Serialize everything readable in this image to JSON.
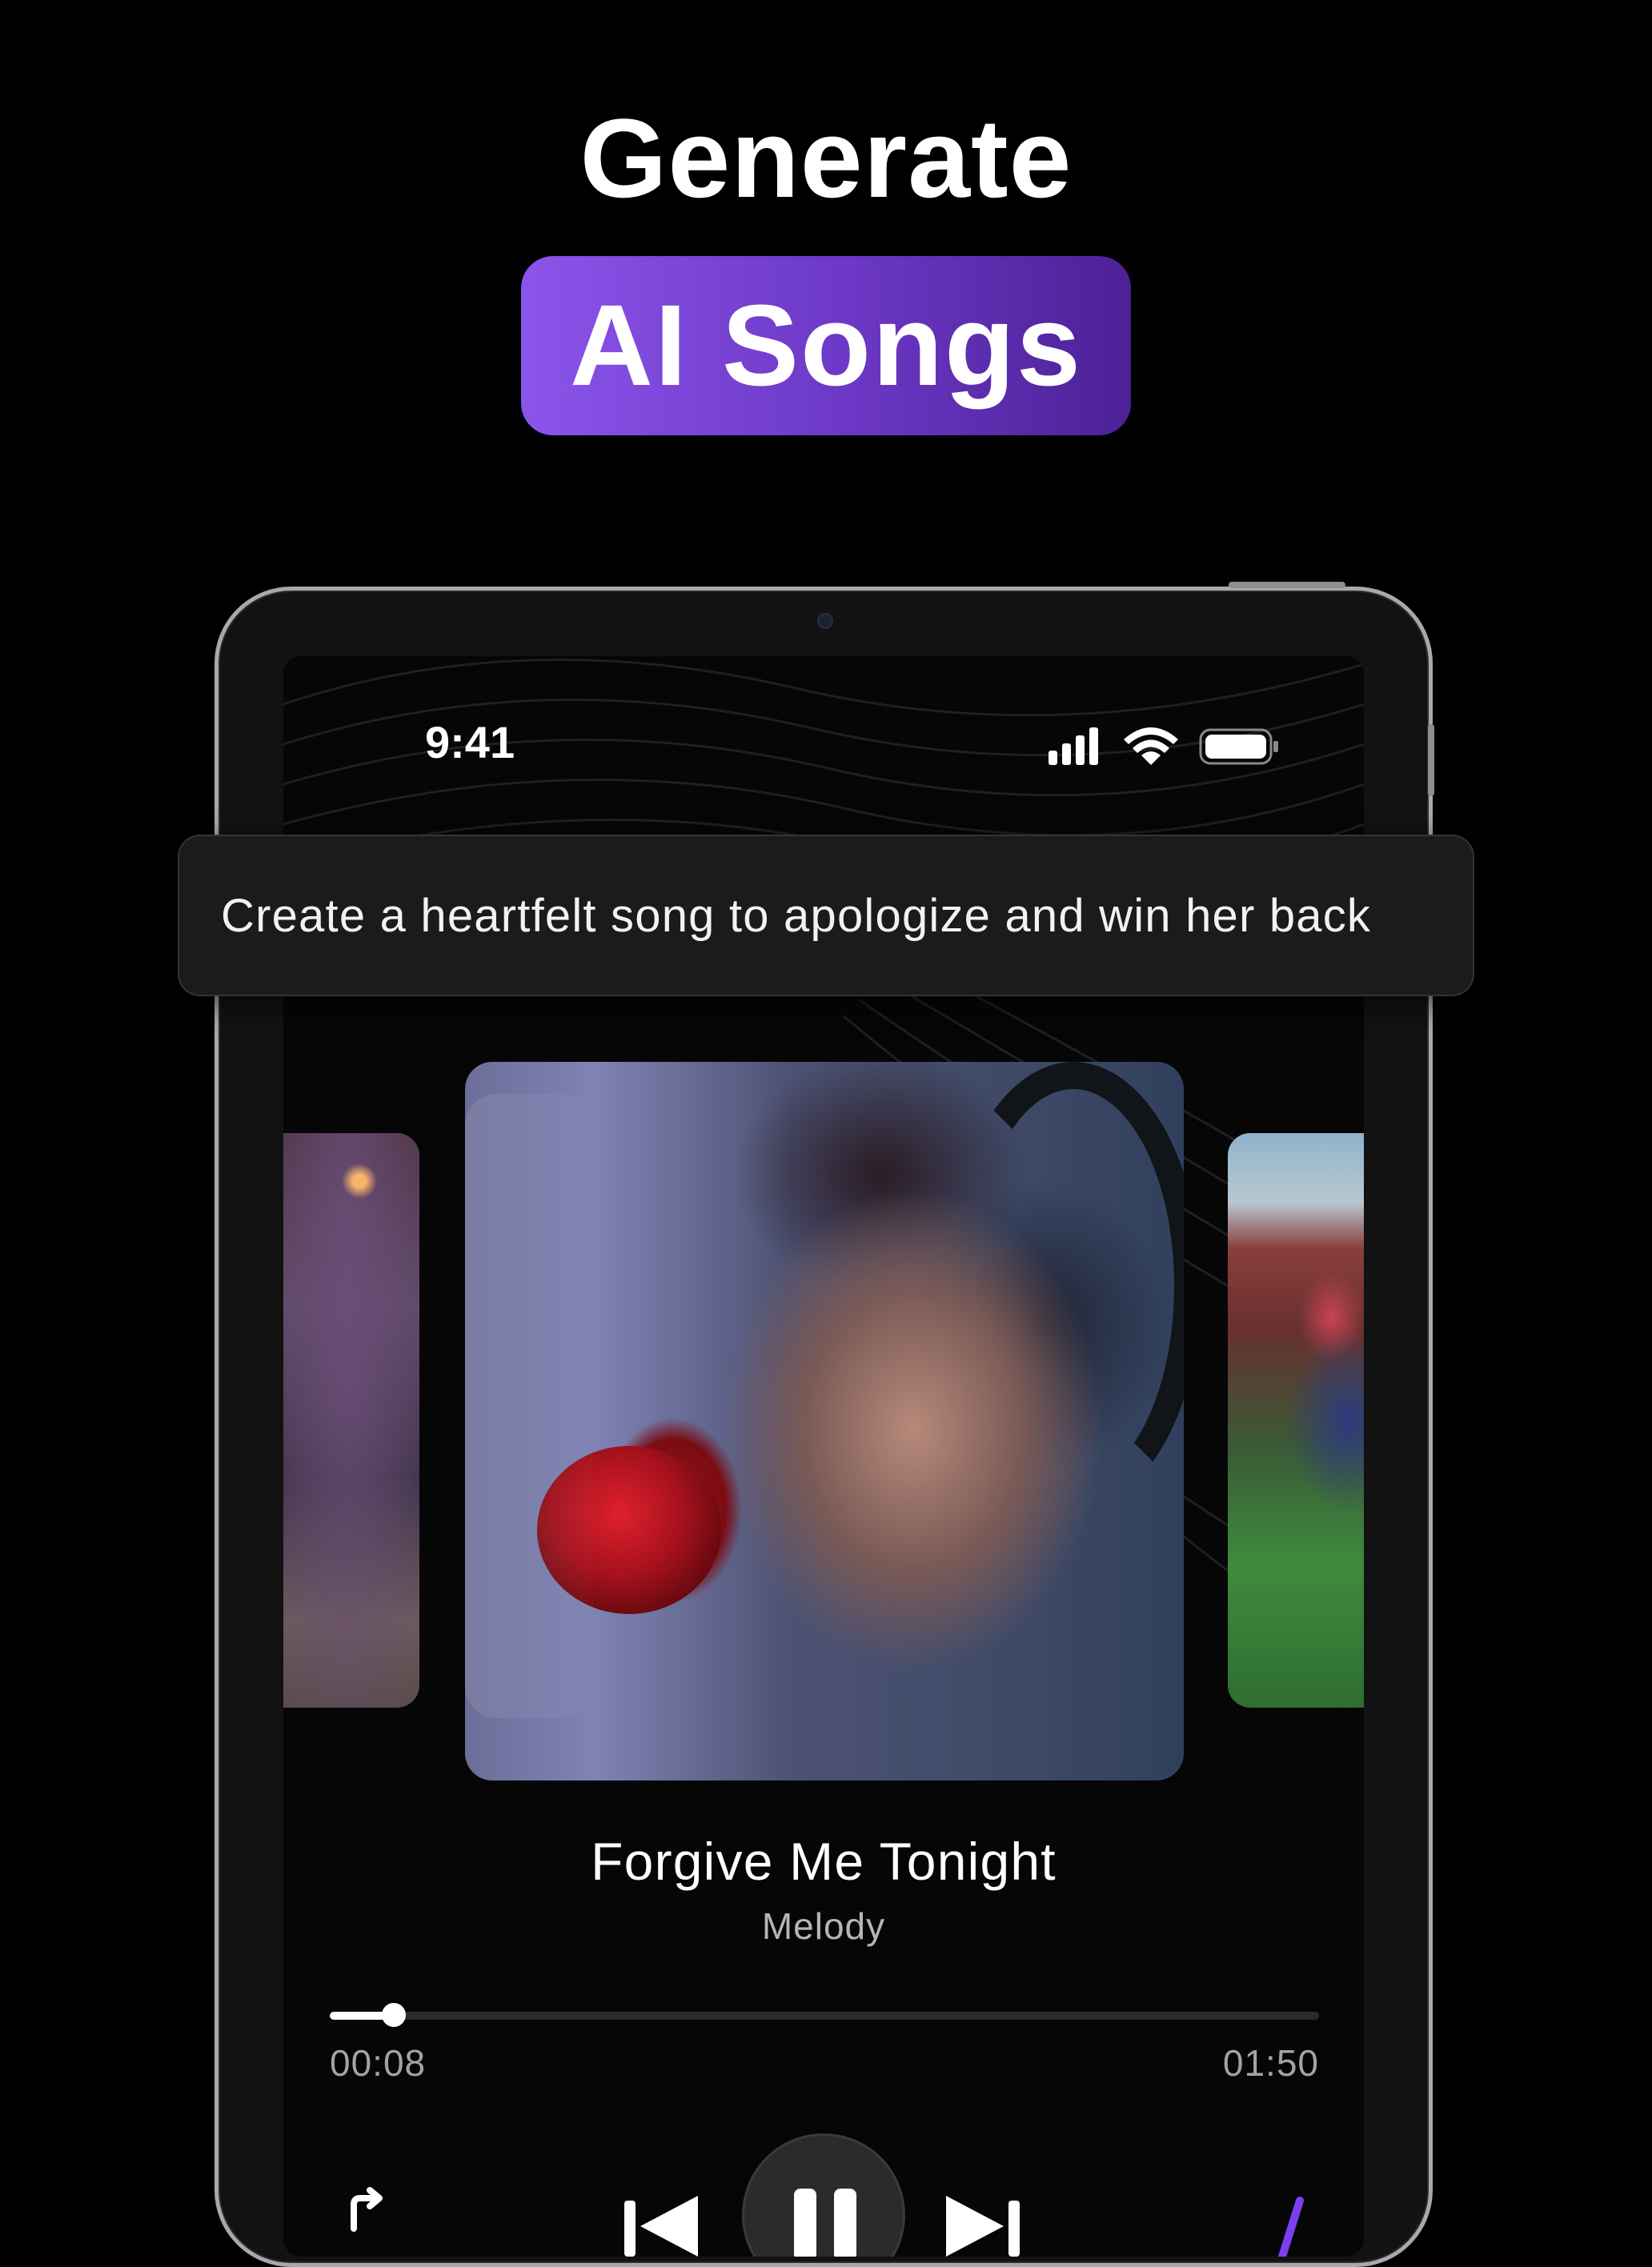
{
  "hero": {
    "line1": "Generate",
    "line2": "AI Songs",
    "pill_gradient": [
      "#8b55ea",
      "#4c2196"
    ]
  },
  "status_bar": {
    "time": "9:41",
    "icons": [
      "cellular-signal-icon",
      "wifi-icon",
      "battery-icon"
    ]
  },
  "prompt": {
    "text": "Create a heartfelt song to apologize and win her back"
  },
  "carousel": {
    "items": [
      "album-art-left",
      "album-art-main",
      "album-art-right"
    ]
  },
  "player": {
    "title": "Forgive Me Tonight",
    "subtitle": "Melody",
    "elapsed": "00:08",
    "duration": "01:50",
    "progress_fraction": 0.065,
    "accent": "#7b3ff0"
  },
  "controls": [
    "share-icon",
    "previous-track-icon",
    "pause-icon",
    "next-track-icon",
    "ai-sparkle-icon"
  ]
}
